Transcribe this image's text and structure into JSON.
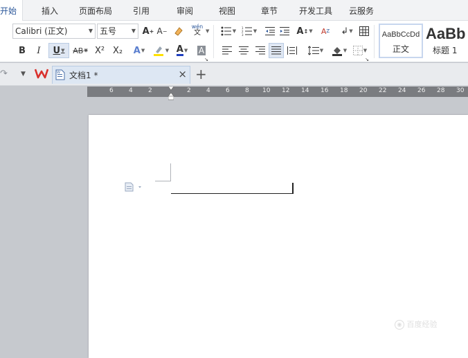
{
  "menu": {
    "tabs": [
      "开始",
      "插入",
      "页面布局",
      "引用",
      "审阅",
      "视图",
      "章节",
      "开发工具",
      "云服务"
    ]
  },
  "ribbon": {
    "font_name": "Calibri (正文)",
    "font_size": "五号",
    "styles": [
      {
        "sample": "AaBbCcDd",
        "name": "正文"
      },
      {
        "sample": "AaBb",
        "name": "标题 1"
      }
    ],
    "icons": {
      "bold": "B",
      "italic": "I",
      "underline": "U",
      "strikethrough": "AB",
      "superscript": "X²",
      "subscript": "X₂",
      "grow_font": "A⁺",
      "shrink_font": "A⁻",
      "pinyin_top": "wén",
      "pinyin_bottom": "文",
      "font_color": "A",
      "char_shading": "A",
      "text_effect": "A"
    }
  },
  "tabbar": {
    "document_title": "文档1 *",
    "close_glyph": "×",
    "new_tab_glyph": "+"
  },
  "ruler": {
    "labels": [
      "6",
      "4",
      "2",
      "2",
      "4",
      "6",
      "8",
      "10",
      "12",
      "14",
      "16",
      "18",
      "20",
      "22",
      "24",
      "26",
      "28",
      "30"
    ]
  },
  "watermark": "百度经验",
  "colors": {
    "accent": "#2b579a",
    "highlight": "#ffe000",
    "font_color_bar": "#1f3fbf",
    "wps_red": "#d9302c"
  }
}
